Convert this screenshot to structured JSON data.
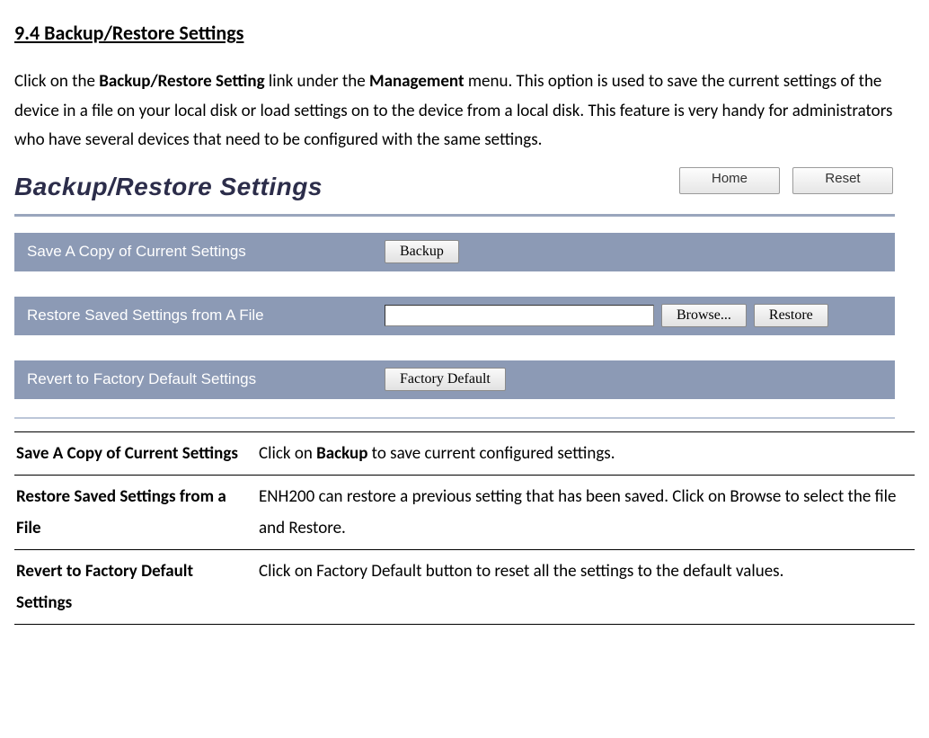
{
  "heading": "9.4 Backup/Restore Settings",
  "intro": {
    "pre1": "Click on the ",
    "b1": "Backup/Restore Setting",
    "mid1": " link under the ",
    "b2": "Management",
    "post1": " menu. This option is used to save the current settings of the device in a file on your local disk or load settings on to the device from a local disk. This feature is very handy for administrators who have several devices that need to be configured with the same settings."
  },
  "panel": {
    "title": "Backup/Restore Settings",
    "home": "Home",
    "reset": "Reset",
    "rows": {
      "save": {
        "label": "Save A Copy of Current Settings",
        "button": "Backup"
      },
      "restore": {
        "label": "Restore Saved Settings from A File",
        "browse": "Browse...",
        "restore_btn": "Restore",
        "file_value": ""
      },
      "revert": {
        "label": "Revert to Factory Default Settings",
        "button": "Factory Default"
      }
    }
  },
  "table": {
    "r1": {
      "term": "Save A Copy of Current Settings",
      "pre": "Click on ",
      "b": "Backup",
      "post": " to save current configured settings."
    },
    "r2": {
      "term": "Restore Saved Settings from a File",
      "desc": "ENH200 can restore a previous setting that has been saved. Click on Browse to select the file and Restore."
    },
    "r3": {
      "term": "Revert to Factory Default Settings",
      "desc": "Click on Factory Default button to reset all the settings to the default values."
    }
  }
}
